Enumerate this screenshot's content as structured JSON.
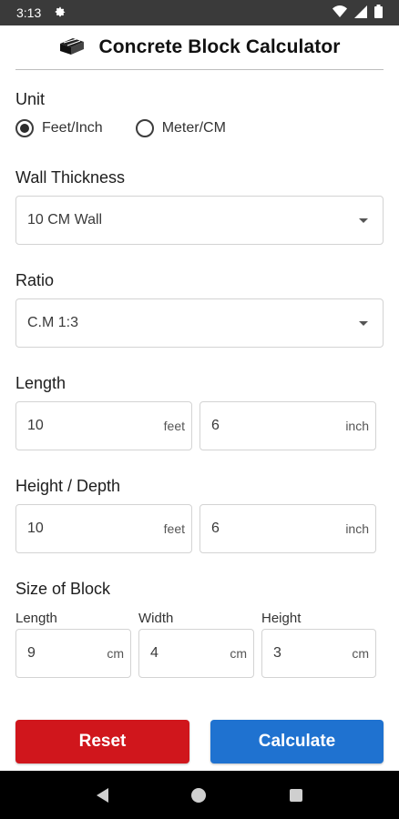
{
  "status_bar": {
    "time": "3:13",
    "settings_icon": "gear-icon",
    "wifi_icon": "wifi-icon",
    "signal_icon": "signal-icon",
    "battery_icon": "battery-icon"
  },
  "app_bar": {
    "icon": "brick-icon",
    "title": "Concrete Block Calculator"
  },
  "unit": {
    "label": "Unit",
    "options": [
      "Feet/Inch",
      "Meter/CM"
    ],
    "selected": "Feet/Inch"
  },
  "wall_thickness": {
    "label": "Wall Thickness",
    "selected": "10 CM Wall"
  },
  "ratio": {
    "label": "Ratio",
    "selected": "C.M 1:3"
  },
  "length": {
    "label": "Length",
    "feet_value": "10",
    "feet_unit": "feet",
    "inch_value": "6",
    "inch_unit": "inch"
  },
  "height": {
    "label": "Height / Depth",
    "feet_value": "10",
    "feet_unit": "feet",
    "inch_value": "6",
    "inch_unit": "inch"
  },
  "block_size": {
    "label": "Size of Block",
    "fields": [
      {
        "label": "Length",
        "value": "9",
        "unit": "cm"
      },
      {
        "label": "Width",
        "value": "4",
        "unit": "cm"
      },
      {
        "label": "Height",
        "value": "3",
        "unit": "cm"
      }
    ]
  },
  "buttons": {
    "reset_label": "Reset",
    "calculate_label": "Calculate"
  },
  "colors": {
    "reset": "#d0161c",
    "calculate": "#1f72d0"
  }
}
